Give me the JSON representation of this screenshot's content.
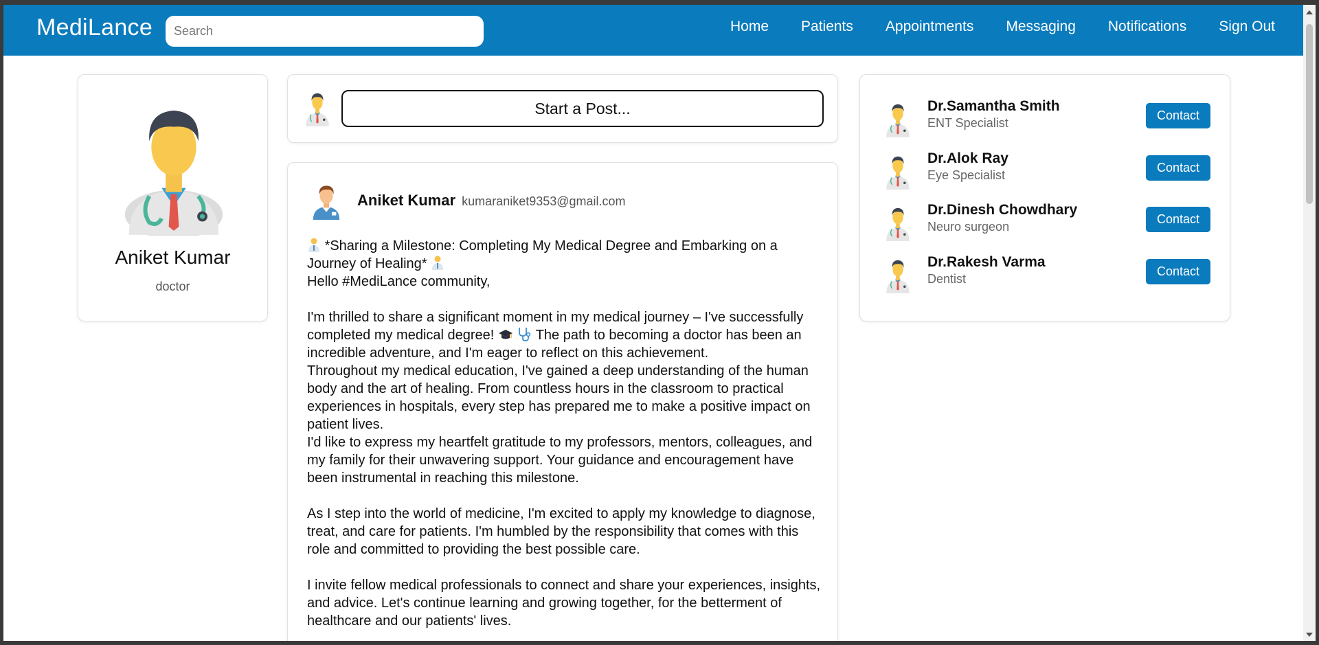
{
  "brand": "MediLance",
  "search": {
    "placeholder": "Search"
  },
  "nav": {
    "home": "Home",
    "patients": "Patients",
    "appointments": "Appointments",
    "messaging": "Messaging",
    "notifications": "Notifications",
    "sign_out": "Sign Out"
  },
  "profile": {
    "name": "Aniket Kumar",
    "role": "doctor"
  },
  "composer": {
    "button_label": "Start a Post..."
  },
  "post": {
    "author": "Aniket Kumar",
    "email": "kumaraniket9353@gmail.com",
    "line_1": "*Sharing a Milestone: Completing My Medical Degree and Embarking on a Journey of Healing*",
    "line_2": "Hello #MediLance community,",
    "para_1a": "I'm thrilled to share a significant moment in my medical journey – I've successfully completed my medical degree!",
    "para_1b": "The path to becoming a doctor has been an incredible adventure, and I'm eager to reflect on this achievement.",
    "para_2": "Throughout my medical education, I've gained a deep understanding of the human body and the art of healing. From countless hours in the classroom to practical experiences in hospitals, every step has prepared me to make a positive impact on patient lives.",
    "para_3": "I'd like to express my heartfelt gratitude to my professors, mentors, colleagues, and my family for their unwavering support. Your guidance and encouragement have been instrumental in reaching this milestone.",
    "para_4": "As I step into the world of medicine, I'm excited to apply my knowledge to diagnose, treat, and care for patients. I'm humbled by the responsibility that comes with this role and committed to providing the best possible care.",
    "para_5": "I invite fellow medical professionals to connect and share your experiences, insights, and advice. Let's continue learning and growing together, for the betterment of healthcare and our patients' lives."
  },
  "doctors": [
    {
      "name": "Dr.Samantha Smith",
      "specialty": "ENT Specialist",
      "action": "Contact"
    },
    {
      "name": "Dr.Alok Ray",
      "specialty": "Eye Specialist",
      "action": "Contact"
    },
    {
      "name": "Dr.Dinesh Chowdhary",
      "specialty": "Neuro surgeon",
      "action": "Contact"
    },
    {
      "name": "Dr.Rakesh Varma",
      "specialty": "Dentist",
      "action": "Contact"
    }
  ],
  "colors": {
    "primary": "#0a7bbd",
    "page_bg": "#ffffff"
  },
  "icons": [
    "doctor-avatar-icon",
    "user-avatar-icon",
    "graduation-cap-icon",
    "stethoscope-icon"
  ]
}
